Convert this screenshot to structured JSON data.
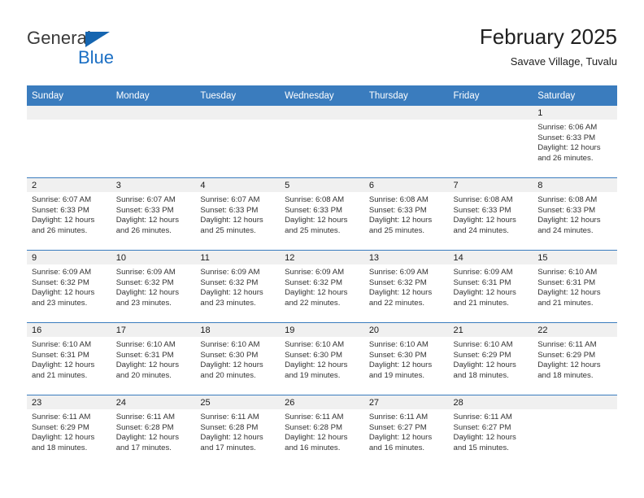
{
  "brand": {
    "name_part1": "General",
    "name_part2": "Blue",
    "accent_color": "#1b6fc4",
    "triangle_color": "#1565b0"
  },
  "header": {
    "title": "February 2025",
    "subtitle": "Savave Village, Tuvalu"
  },
  "calendar": {
    "header_color": "#3a7cbe",
    "weekdays": [
      "Sunday",
      "Monday",
      "Tuesday",
      "Wednesday",
      "Thursday",
      "Friday",
      "Saturday"
    ],
    "weeks": [
      [
        {
          "day": "",
          "sunrise": "",
          "sunset": "",
          "daylight_line1": "",
          "daylight_line2": ""
        },
        {
          "day": "",
          "sunrise": "",
          "sunset": "",
          "daylight_line1": "",
          "daylight_line2": ""
        },
        {
          "day": "",
          "sunrise": "",
          "sunset": "",
          "daylight_line1": "",
          "daylight_line2": ""
        },
        {
          "day": "",
          "sunrise": "",
          "sunset": "",
          "daylight_line1": "",
          "daylight_line2": ""
        },
        {
          "day": "",
          "sunrise": "",
          "sunset": "",
          "daylight_line1": "",
          "daylight_line2": ""
        },
        {
          "day": "",
          "sunrise": "",
          "sunset": "",
          "daylight_line1": "",
          "daylight_line2": ""
        },
        {
          "day": "1",
          "sunrise": "Sunrise: 6:06 AM",
          "sunset": "Sunset: 6:33 PM",
          "daylight_line1": "Daylight: 12 hours",
          "daylight_line2": "and 26 minutes."
        }
      ],
      [
        {
          "day": "2",
          "sunrise": "Sunrise: 6:07 AM",
          "sunset": "Sunset: 6:33 PM",
          "daylight_line1": "Daylight: 12 hours",
          "daylight_line2": "and 26 minutes."
        },
        {
          "day": "3",
          "sunrise": "Sunrise: 6:07 AM",
          "sunset": "Sunset: 6:33 PM",
          "daylight_line1": "Daylight: 12 hours",
          "daylight_line2": "and 26 minutes."
        },
        {
          "day": "4",
          "sunrise": "Sunrise: 6:07 AM",
          "sunset": "Sunset: 6:33 PM",
          "daylight_line1": "Daylight: 12 hours",
          "daylight_line2": "and 25 minutes."
        },
        {
          "day": "5",
          "sunrise": "Sunrise: 6:08 AM",
          "sunset": "Sunset: 6:33 PM",
          "daylight_line1": "Daylight: 12 hours",
          "daylight_line2": "and 25 minutes."
        },
        {
          "day": "6",
          "sunrise": "Sunrise: 6:08 AM",
          "sunset": "Sunset: 6:33 PM",
          "daylight_line1": "Daylight: 12 hours",
          "daylight_line2": "and 25 minutes."
        },
        {
          "day": "7",
          "sunrise": "Sunrise: 6:08 AM",
          "sunset": "Sunset: 6:33 PM",
          "daylight_line1": "Daylight: 12 hours",
          "daylight_line2": "and 24 minutes."
        },
        {
          "day": "8",
          "sunrise": "Sunrise: 6:08 AM",
          "sunset": "Sunset: 6:33 PM",
          "daylight_line1": "Daylight: 12 hours",
          "daylight_line2": "and 24 minutes."
        }
      ],
      [
        {
          "day": "9",
          "sunrise": "Sunrise: 6:09 AM",
          "sunset": "Sunset: 6:32 PM",
          "daylight_line1": "Daylight: 12 hours",
          "daylight_line2": "and 23 minutes."
        },
        {
          "day": "10",
          "sunrise": "Sunrise: 6:09 AM",
          "sunset": "Sunset: 6:32 PM",
          "daylight_line1": "Daylight: 12 hours",
          "daylight_line2": "and 23 minutes."
        },
        {
          "day": "11",
          "sunrise": "Sunrise: 6:09 AM",
          "sunset": "Sunset: 6:32 PM",
          "daylight_line1": "Daylight: 12 hours",
          "daylight_line2": "and 23 minutes."
        },
        {
          "day": "12",
          "sunrise": "Sunrise: 6:09 AM",
          "sunset": "Sunset: 6:32 PM",
          "daylight_line1": "Daylight: 12 hours",
          "daylight_line2": "and 22 minutes."
        },
        {
          "day": "13",
          "sunrise": "Sunrise: 6:09 AM",
          "sunset": "Sunset: 6:32 PM",
          "daylight_line1": "Daylight: 12 hours",
          "daylight_line2": "and 22 minutes."
        },
        {
          "day": "14",
          "sunrise": "Sunrise: 6:09 AM",
          "sunset": "Sunset: 6:31 PM",
          "daylight_line1": "Daylight: 12 hours",
          "daylight_line2": "and 21 minutes."
        },
        {
          "day": "15",
          "sunrise": "Sunrise: 6:10 AM",
          "sunset": "Sunset: 6:31 PM",
          "daylight_line1": "Daylight: 12 hours",
          "daylight_line2": "and 21 minutes."
        }
      ],
      [
        {
          "day": "16",
          "sunrise": "Sunrise: 6:10 AM",
          "sunset": "Sunset: 6:31 PM",
          "daylight_line1": "Daylight: 12 hours",
          "daylight_line2": "and 21 minutes."
        },
        {
          "day": "17",
          "sunrise": "Sunrise: 6:10 AM",
          "sunset": "Sunset: 6:31 PM",
          "daylight_line1": "Daylight: 12 hours",
          "daylight_line2": "and 20 minutes."
        },
        {
          "day": "18",
          "sunrise": "Sunrise: 6:10 AM",
          "sunset": "Sunset: 6:30 PM",
          "daylight_line1": "Daylight: 12 hours",
          "daylight_line2": "and 20 minutes."
        },
        {
          "day": "19",
          "sunrise": "Sunrise: 6:10 AM",
          "sunset": "Sunset: 6:30 PM",
          "daylight_line1": "Daylight: 12 hours",
          "daylight_line2": "and 19 minutes."
        },
        {
          "day": "20",
          "sunrise": "Sunrise: 6:10 AM",
          "sunset": "Sunset: 6:30 PM",
          "daylight_line1": "Daylight: 12 hours",
          "daylight_line2": "and 19 minutes."
        },
        {
          "day": "21",
          "sunrise": "Sunrise: 6:10 AM",
          "sunset": "Sunset: 6:29 PM",
          "daylight_line1": "Daylight: 12 hours",
          "daylight_line2": "and 18 minutes."
        },
        {
          "day": "22",
          "sunrise": "Sunrise: 6:11 AM",
          "sunset": "Sunset: 6:29 PM",
          "daylight_line1": "Daylight: 12 hours",
          "daylight_line2": "and 18 minutes."
        }
      ],
      [
        {
          "day": "23",
          "sunrise": "Sunrise: 6:11 AM",
          "sunset": "Sunset: 6:29 PM",
          "daylight_line1": "Daylight: 12 hours",
          "daylight_line2": "and 18 minutes."
        },
        {
          "day": "24",
          "sunrise": "Sunrise: 6:11 AM",
          "sunset": "Sunset: 6:28 PM",
          "daylight_line1": "Daylight: 12 hours",
          "daylight_line2": "and 17 minutes."
        },
        {
          "day": "25",
          "sunrise": "Sunrise: 6:11 AM",
          "sunset": "Sunset: 6:28 PM",
          "daylight_line1": "Daylight: 12 hours",
          "daylight_line2": "and 17 minutes."
        },
        {
          "day": "26",
          "sunrise": "Sunrise: 6:11 AM",
          "sunset": "Sunset: 6:28 PM",
          "daylight_line1": "Daylight: 12 hours",
          "daylight_line2": "and 16 minutes."
        },
        {
          "day": "27",
          "sunrise": "Sunrise: 6:11 AM",
          "sunset": "Sunset: 6:27 PM",
          "daylight_line1": "Daylight: 12 hours",
          "daylight_line2": "and 16 minutes."
        },
        {
          "day": "28",
          "sunrise": "Sunrise: 6:11 AM",
          "sunset": "Sunset: 6:27 PM",
          "daylight_line1": "Daylight: 12 hours",
          "daylight_line2": "and 15 minutes."
        },
        {
          "day": "",
          "sunrise": "",
          "sunset": "",
          "daylight_line1": "",
          "daylight_line2": ""
        }
      ]
    ]
  }
}
